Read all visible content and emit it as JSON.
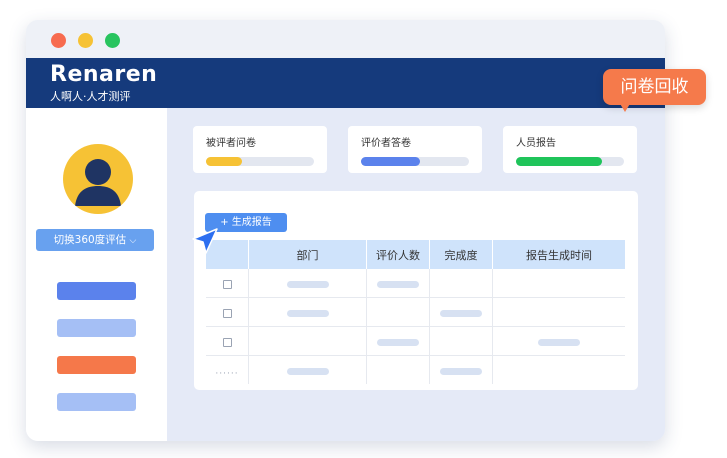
{
  "window": {
    "dot_colors": [
      "#f76b4f",
      "#f6c235",
      "#28c45f"
    ]
  },
  "header": {
    "logo_main": "Renaren",
    "logo_sub": "人啊人·人才测评",
    "bg_color": "#153a7c"
  },
  "sidebar": {
    "avatar_icon": "user-avatar-icon",
    "switch_button_label": "切换360度评估",
    "switch_chevron": "⌵",
    "menu_bar_colors": [
      "#5b82ec",
      "#a5bff5",
      "#f5784a",
      "#a5bff5"
    ]
  },
  "cards": [
    {
      "label": "被评者问卷",
      "progress": 0.33,
      "color": "#f6c235"
    },
    {
      "label": "评价者答卷",
      "progress": 0.55,
      "color": "#5b82ec"
    },
    {
      "label": "人员报告",
      "progress": 0.8,
      "color": "#1fc45a"
    }
  ],
  "panel": {
    "generate_button_label": "+ 生成报告",
    "table": {
      "columns": [
        "",
        "部门",
        "评价人数",
        "完成度",
        "报告生成时间"
      ]
    }
  },
  "callout": {
    "label": "问卷回收"
  }
}
